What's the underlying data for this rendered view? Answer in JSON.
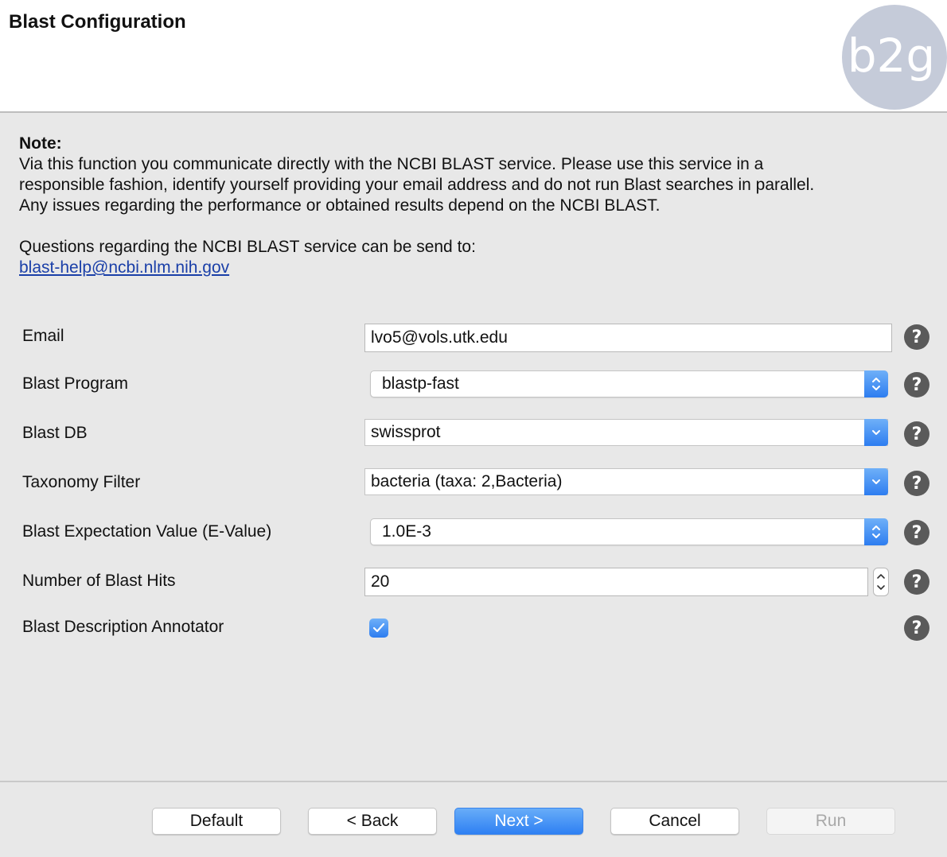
{
  "header": {
    "title": "Blast Configuration",
    "logo_text": "b2g"
  },
  "note": {
    "label": "Note:",
    "line1": "Via this function you communicate directly with the NCBI BLAST service. Please use this service in a",
    "line2": "responsible fashion, identify yourself providing your email address and do not run Blast searches in parallel.",
    "line3": "Any issues regarding the performance or obtained results depend on the NCBI BLAST.",
    "questions": "Questions regarding the NCBI BLAST service can be send to:",
    "email_link": "blast-help@ncbi.nlm.nih.gov"
  },
  "form": {
    "email": {
      "label": "Email",
      "value": "lvo5@vols.utk.edu"
    },
    "program": {
      "label": "Blast Program",
      "value": "blastp-fast"
    },
    "db": {
      "label": "Blast DB",
      "value": "swissprot"
    },
    "taxonomy": {
      "label": "Taxonomy Filter",
      "value": "bacteria (taxa: 2,Bacteria)"
    },
    "evalue": {
      "label": "Blast Expectation Value (E-Value)",
      "value": "1.0E-3"
    },
    "hits": {
      "label": "Number of Blast Hits",
      "value": "20"
    },
    "annotator": {
      "label": "Blast Description Annotator",
      "checked": true
    },
    "help_glyph": "?"
  },
  "buttons": {
    "default": "Default",
    "back": "< Back",
    "next": "Next >",
    "cancel": "Cancel",
    "run": "Run"
  },
  "colors": {
    "accent": "#2d7df0",
    "link": "#1a3fa8",
    "help_icon": "#5a5a5a"
  }
}
